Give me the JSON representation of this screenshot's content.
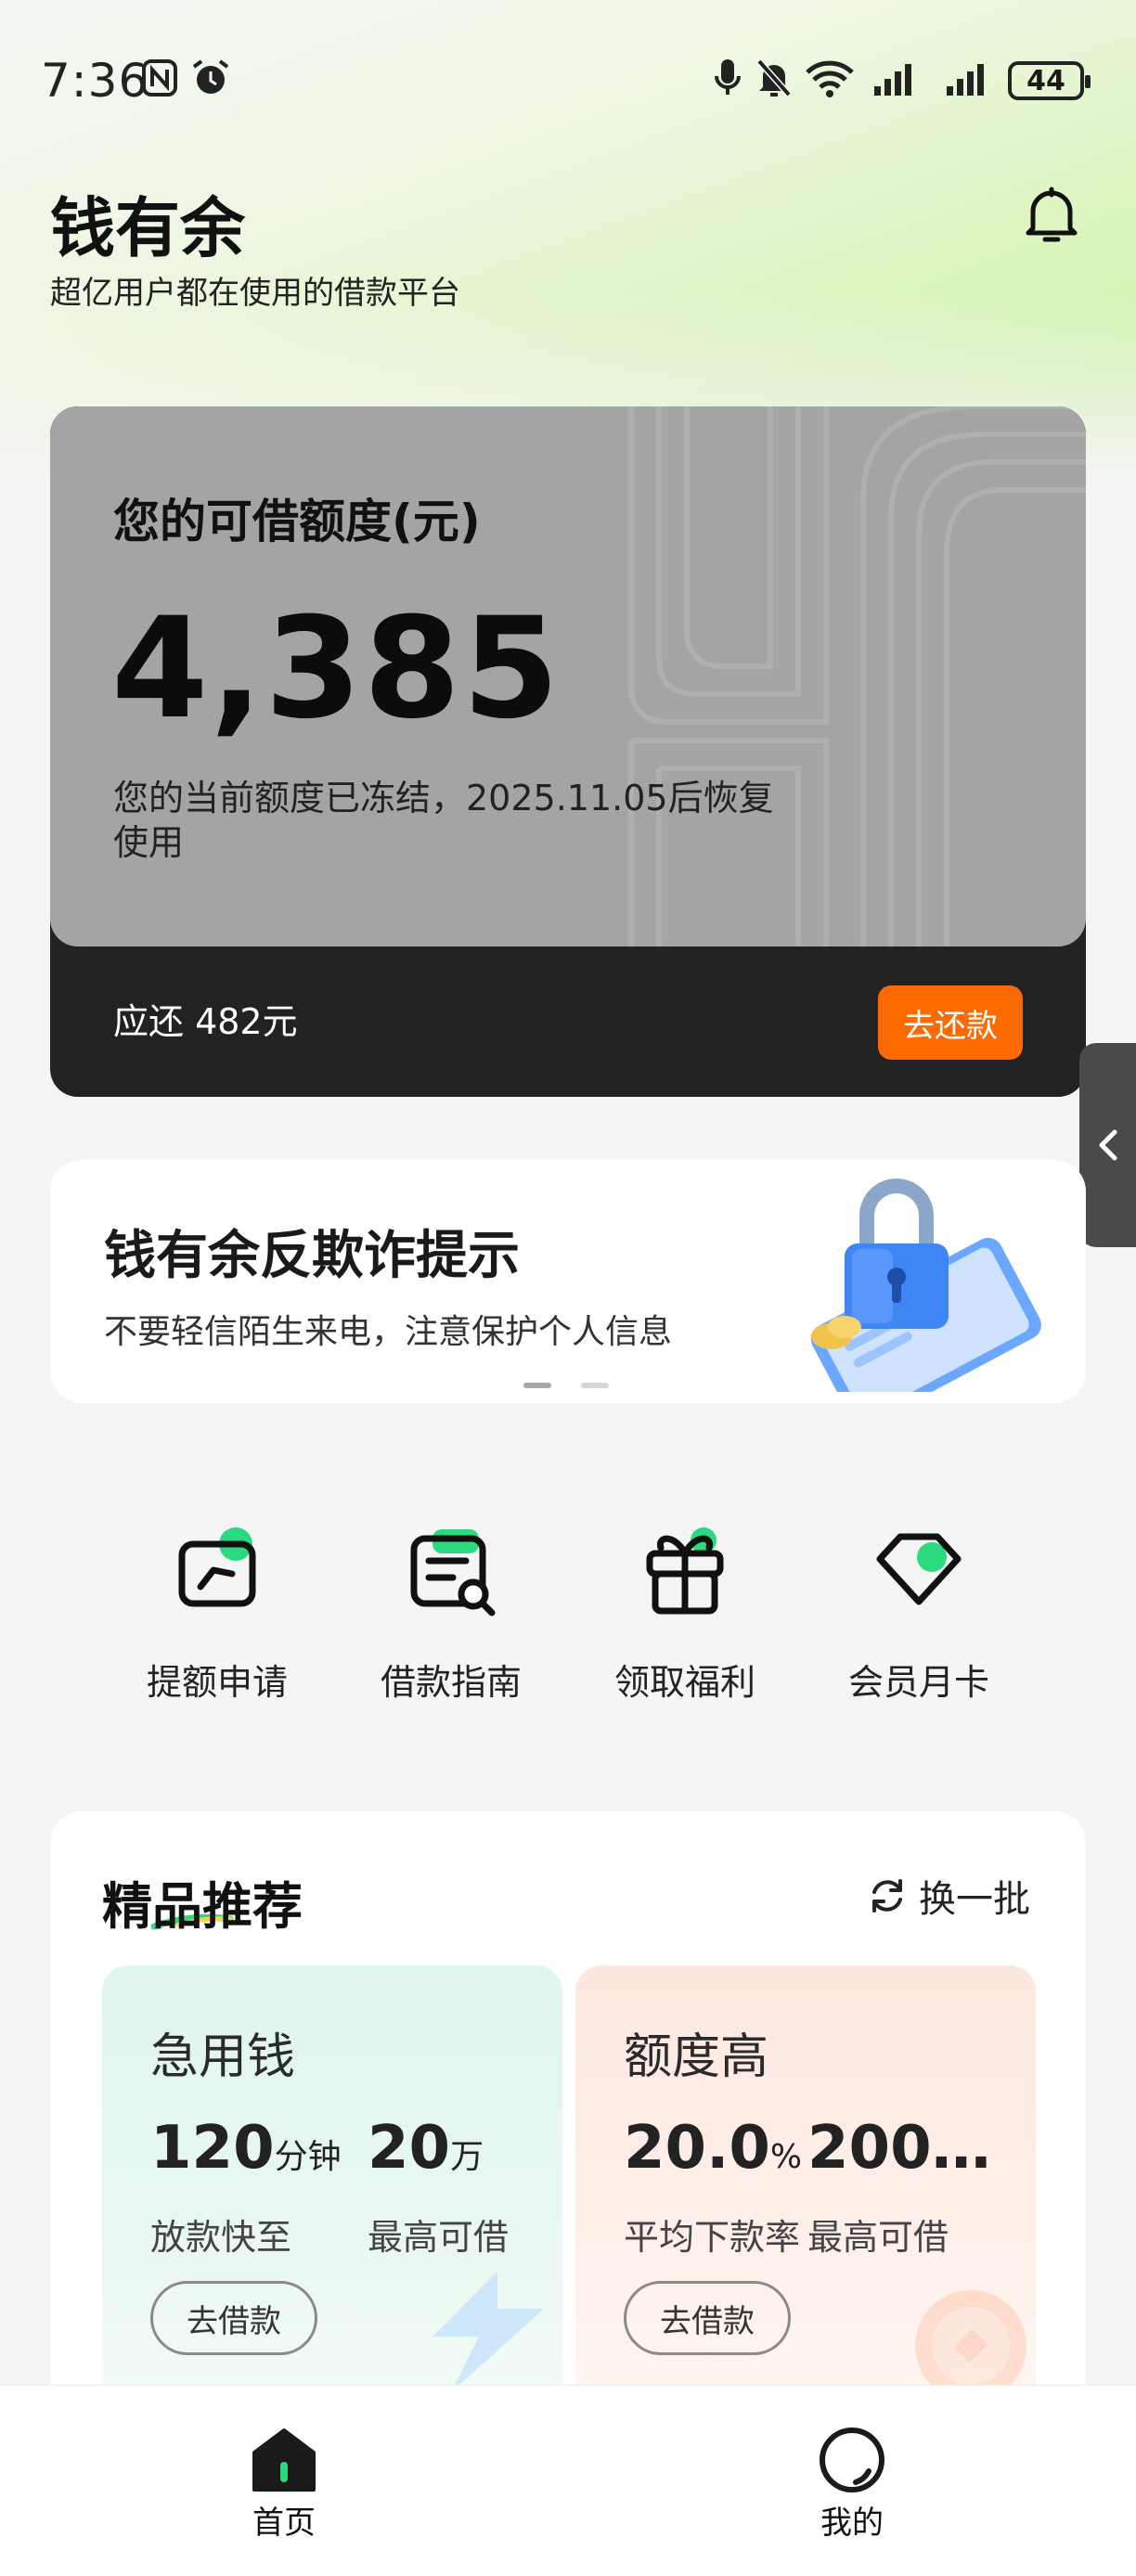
{
  "status_bar": {
    "time": "7:36",
    "battery": "44",
    "icons": [
      "nfc-icon",
      "alarm-icon",
      "mic-icon",
      "bell-off-icon",
      "wifi-icon",
      "signal-icon",
      "signal-icon"
    ]
  },
  "header": {
    "title": "钱有余",
    "subtitle": "超亿用户都在使用的借款平台",
    "icon": "bell-icon"
  },
  "credit_card": {
    "label": "您的可借额度(元)",
    "amount": "4,385",
    "note": "您的当前额度已冻结，2025.11.05后恢复使用",
    "due_text": "应还 482元",
    "repay_button": "去还款",
    "repay_color": "#ff6a00"
  },
  "side_tab": {
    "icon": "chevron-left-icon"
  },
  "banner": {
    "title": "钱有余反欺诈提示",
    "subtitle": "不要轻信陌生来电，注意保护个人信息",
    "slides_total": 2,
    "active_slide": 1
  },
  "quick_menu": [
    {
      "label": "提额申请",
      "icon": "credit-increase-icon"
    },
    {
      "label": "借款指南",
      "icon": "guide-icon"
    },
    {
      "label": "领取福利",
      "icon": "gift-icon"
    },
    {
      "label": "会员月卡",
      "icon": "vip-card-icon"
    }
  ],
  "recommend": {
    "title": "精品推荐",
    "refresh_label": "换一批",
    "products": [
      {
        "title": "急用钱",
        "stat1_value": "120",
        "stat1_unit": "分钟",
        "stat1_label": "放款快至",
        "stat2_value": "20",
        "stat2_unit": "万",
        "stat2_label": "最高可借",
        "button": "去借款"
      },
      {
        "title": "额度高",
        "stat1_value": "20.0",
        "stat1_unit": "%",
        "stat1_label": "平均下款率",
        "stat2_value": "200…",
        "stat2_unit": "",
        "stat2_label": "最高可借",
        "button": "去借款"
      }
    ]
  },
  "bottom_nav": [
    {
      "label": "首页",
      "icon": "home-icon",
      "active": true
    },
    {
      "label": "我的",
      "icon": "profile-icon",
      "active": false
    }
  ],
  "colors": {
    "brand_green": "#2bd97e",
    "accent_orange": "#ff6a00",
    "card_gray": "#a4a4a4",
    "card_dark": "#222222"
  }
}
